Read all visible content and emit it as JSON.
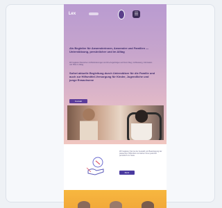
{
  "preview": {
    "logo_text": "Lex",
    "menu_icon": "☰",
    "hero": {
      "heading": "Als Begleiter für Anwenderinnen, Anwender und Familien — Unterstützung, persönlicher und im Alltag",
      "body": "Wir begleiten Menschen mit Behinderungen und ihre Angehörigen auf ihrem Weg, mit Beratung, Information und Hilfe im Alltag.",
      "subheading": "Sofort aktuelle Begleitung durch Unterstützer für die Familie und auch zur Hilfsmittel-Versorgung für Kinder, Jugendliche und junge Erwachsene",
      "cta_label": "Kontakt",
      "photo": "photo-man-and-girl-in-wheelchair"
    },
    "section2": {
      "text": "Wir begleiten Sie bei der Auswahl und Beantragung der passenden Hilfsmittel und stehen Ihnen jederzeit persönlich zur Seite.",
      "cta_label": "Mehr",
      "illustration": "hand-holding-wrench-illustration"
    },
    "section3": {
      "background": "#f7b73f"
    }
  }
}
